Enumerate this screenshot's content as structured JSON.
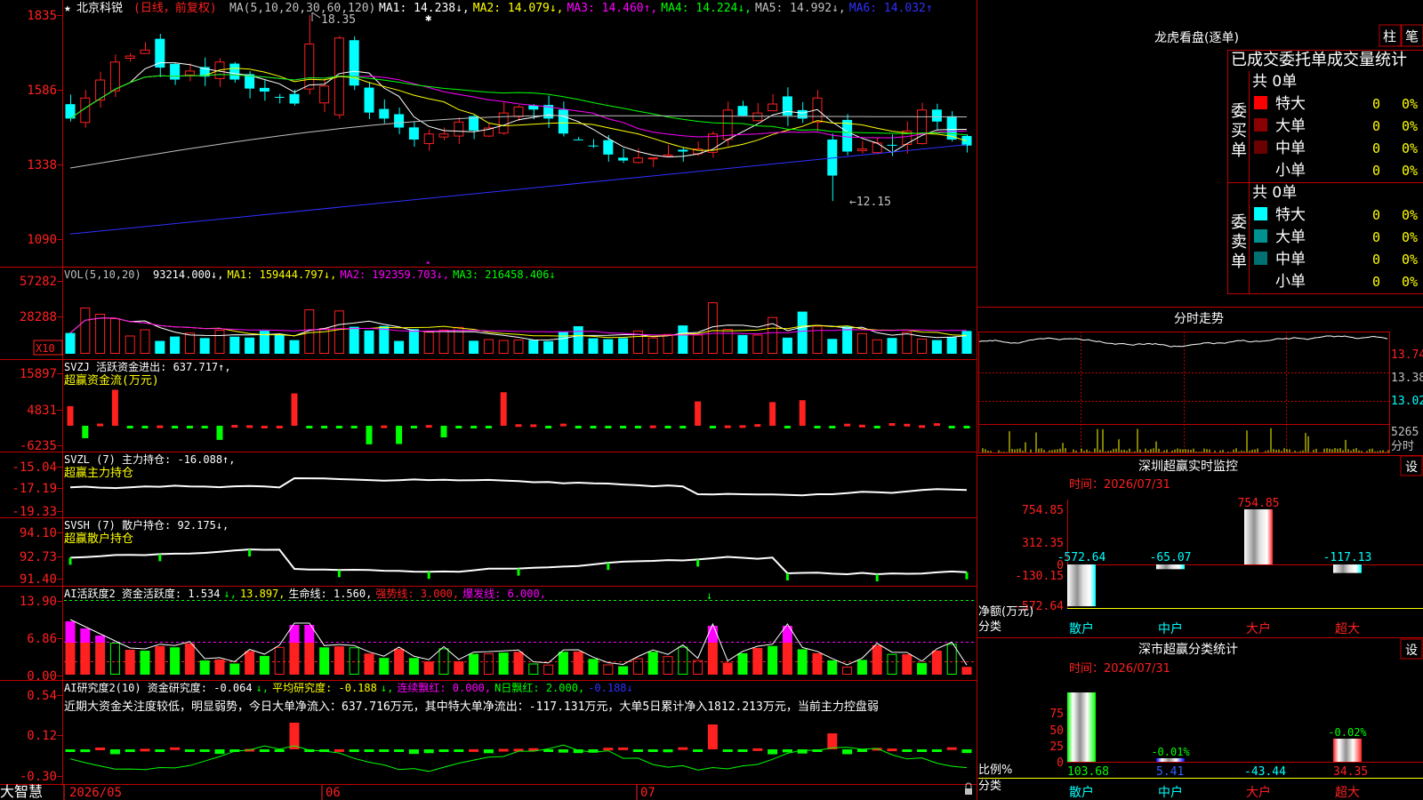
{
  "app": {
    "name": "大智慧"
  },
  "stock": {
    "name": "北京科锐",
    "mode": "(日线，前复权)"
  },
  "main_panel": {
    "ma_label": "MA(5,10,20,30,60,120)",
    "ma_values": [
      {
        "name": "MA1",
        "value": "14.238↓,",
        "color": "#ffffff"
      },
      {
        "name": "MA2",
        "value": "14.079↓,",
        "color": "#ffff00"
      },
      {
        "name": "MA3",
        "value": "14.460↑,",
        "color": "#ff00ff"
      },
      {
        "name": "MA4",
        "value": "14.224↓,",
        "color": "#00ff00"
      },
      {
        "name": "MA5",
        "value": "14.992↓,",
        "color": "#c0c0c0"
      },
      {
        "name": "MA6",
        "value": "14.032↑",
        "color": "#3030ff"
      }
    ],
    "y_ticks": [
      "1835",
      "1586",
      "1338",
      "1090"
    ],
    "high_label": "18.35",
    "low_label": "←12.15"
  },
  "vol_panel": {
    "label": "VOL(5,10,20)",
    "values": [
      {
        "name": "",
        "value": "93214.000↓,",
        "color": "#ffffff"
      },
      {
        "name": "MA1",
        "value": "159444.797↓,",
        "color": "#ffff00"
      },
      {
        "name": "MA2",
        "value": "192359.703↓,",
        "color": "#ff00ff"
      },
      {
        "name": "MA3",
        "value": "216458.406↓",
        "color": "#00ff00"
      }
    ],
    "y_ticks": [
      "57282",
      "28288"
    ],
    "unit": "X10"
  },
  "svzj_panel": {
    "label": "SVZJ  活跃资金进出: 637.717↑,",
    "sublabel": "超赢资金流(万元)",
    "y_ticks": [
      "15897",
      "4831",
      "-6235"
    ]
  },
  "svzl_panel": {
    "label": "SVZL (7) 主力持仓: -16.088↑,",
    "sublabel": "超赢主力持仓",
    "y_ticks": [
      "-15.04",
      "-17.19",
      "-19.33"
    ]
  },
  "svsh_panel": {
    "label": "SVSH (7) 散户持仓: 92.175↓,",
    "sublabel": "超赢散户持仓",
    "y_ticks": [
      "94.10",
      "92.73",
      "91.40"
    ]
  },
  "ai_active_panel": {
    "parts": [
      {
        "text": "AI活跃度2 资金活跃度: 1.534",
        "color": "#ffffff"
      },
      {
        "text": "↓,",
        "color": "#00ff00"
      },
      {
        "text": "13.897,",
        "color": "#ffff00"
      },
      {
        "text": "生命线: 1.560,",
        "color": "#ffffff"
      },
      {
        "text": "强势线: 3.000,",
        "color": "#ff2020"
      },
      {
        "text": "爆发线: 6.000,",
        "color": "#ff00ff"
      }
    ],
    "y_ticks": [
      "13.90",
      "6.86",
      "0.00"
    ]
  },
  "ai_research_panel": {
    "parts": [
      {
        "text": "AI研究度2(10) 资金研究度: -0.064",
        "color": "#ffffff"
      },
      {
        "text": "↓,",
        "color": "#00ff00"
      },
      {
        "text": "平均研究度: -0.188",
        "color": "#ffff00"
      },
      {
        "text": "↓,",
        "color": "#00ff00"
      },
      {
        "text": "连续飘红: 0.000,",
        "color": "#ff00ff"
      },
      {
        "text": "N日飘红: 2.000,",
        "color": "#00ff00"
      },
      {
        "text": "-0.188↓",
        "color": "#3030ff"
      }
    ],
    "commentary": "近期大资金关注度较低，明显弱势，今日大单净流入：637.716万元，其中特大单净流出：-117.131万元，大单5日累计净入1812.213万元，当前主力控盘弱",
    "y_ticks": [
      "0.54",
      "0.12",
      "-0.30"
    ]
  },
  "date_axis": [
    "2026/05",
    "06",
    "07"
  ],
  "lhb": {
    "title": "龙虎看盘(逐单)",
    "btn_zhu": "柱",
    "btn_bi": "笔",
    "header": "已成交委托单成交量统计",
    "buy_label": "委买单",
    "sell_label": "委卖单",
    "buy_total": "共 0单",
    "sell_total": "共 0单",
    "buy_rows": [
      {
        "label": "特大",
        "count": "0",
        "pct": "0%",
        "color": "#ff0000"
      },
      {
        "label": "大单",
        "count": "0",
        "pct": "0%",
        "color": "#8b0000"
      },
      {
        "label": "中单",
        "count": "0",
        "pct": "0%",
        "color": "#6a0000"
      },
      {
        "label": "小单",
        "count": "0",
        "pct": "0%",
        "color": ""
      }
    ],
    "sell_rows": [
      {
        "label": "特大",
        "count": "0",
        "pct": "0%",
        "color": "#00ffff"
      },
      {
        "label": "大单",
        "count": "0",
        "pct": "0%",
        "color": "#009090"
      },
      {
        "label": "中单",
        "count": "0",
        "pct": "0%",
        "color": "#007070"
      },
      {
        "label": "小单",
        "count": "0",
        "pct": "0%",
        "color": ""
      }
    ]
  },
  "intraday": {
    "title": "分时走势",
    "prices": [
      "13.74",
      "13.38",
      "13.02"
    ],
    "vol": "5265",
    "fenshi": "分时"
  },
  "monitor": {
    "title": "深圳超赢实时监控",
    "settings": "设",
    "date": "时间：2026/07/31",
    "y_ticks": [
      "754.85",
      "312.35",
      "0",
      "-130.15",
      "-572.64"
    ],
    "y_label": "净额(万元)",
    "cat_label": "分类",
    "categories": [
      "散户",
      "中户",
      "大户",
      "超大"
    ],
    "values": [
      -572.64,
      -65.07,
      754.85,
      -117.13
    ],
    "value_labels": [
      "-572.64",
      "-65.07",
      "754.85",
      "-117.13"
    ]
  },
  "classify": {
    "title": "深市超赢分类统计",
    "settings": "设",
    "date": "时间：2026/07/31",
    "y_ticks": [
      "75",
      "50",
      "25",
      "0"
    ],
    "y_label": "比例%",
    "cat_label": "分类",
    "categories": [
      "散户",
      "中户",
      "大户",
      "超大"
    ],
    "top_labels": [
      "",
      "-0.01%",
      "",
      "-0.02%"
    ],
    "bottom_labels": [
      "103.68",
      "5.41",
      "-43.44",
      "34.35"
    ]
  }
}
